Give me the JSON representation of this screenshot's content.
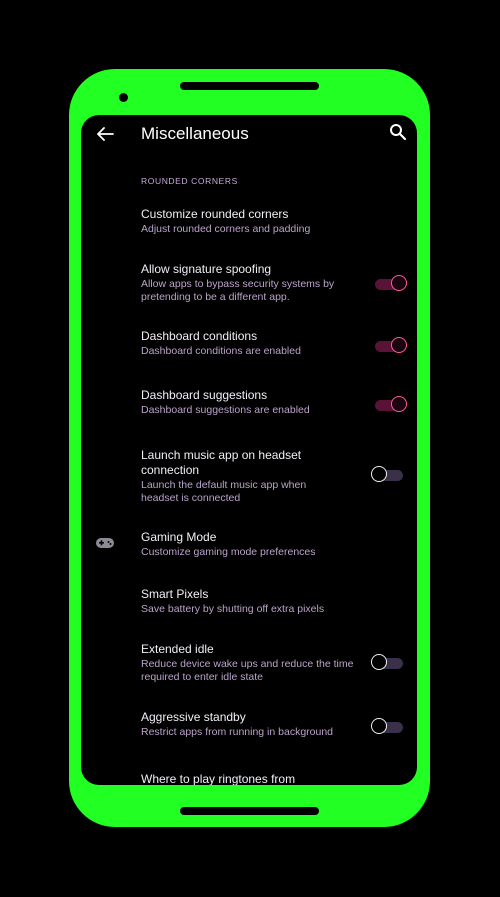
{
  "header": {
    "title": "Miscellaneous"
  },
  "section": {
    "label": "ROUNDED CORNERS"
  },
  "prefs": [
    {
      "title": "Customize rounded corners",
      "summary": "Adjust rounded corners and padding"
    },
    {
      "title": "Allow signature spoofing",
      "summary": "Allow apps to bypass security systems by pretending to be a different app.",
      "switch": "on"
    },
    {
      "title": "Dashboard conditions",
      "summary": "Dashboard conditions are enabled",
      "switch": "on"
    },
    {
      "title": "Dashboard suggestions",
      "summary": "Dashboard suggestions are enabled",
      "switch": "on"
    },
    {
      "title": "Launch music app on headset connection",
      "summary": "Launch the default music app when headset is connected",
      "switch": "off"
    },
    {
      "title": "Gaming Mode",
      "summary": "Customize gaming mode preferences",
      "icon": "gamepad-icon"
    },
    {
      "title": "Smart Pixels",
      "summary": "Save battery by shutting off extra pixels"
    },
    {
      "title": "Extended idle",
      "summary": "Reduce device wake ups and reduce the time required to enter idle state",
      "switch": "off"
    },
    {
      "title": "Aggressive standby",
      "summary": "Restrict apps from running in background",
      "switch": "off"
    },
    {
      "title": "Where to play ringtones from",
      "summary": ""
    }
  ],
  "colors": {
    "frame": "#22ff22",
    "accent": "#ff5b9a",
    "background": "#000000"
  },
  "icons": {
    "back": "arrow-left-icon",
    "search": "search-icon"
  }
}
